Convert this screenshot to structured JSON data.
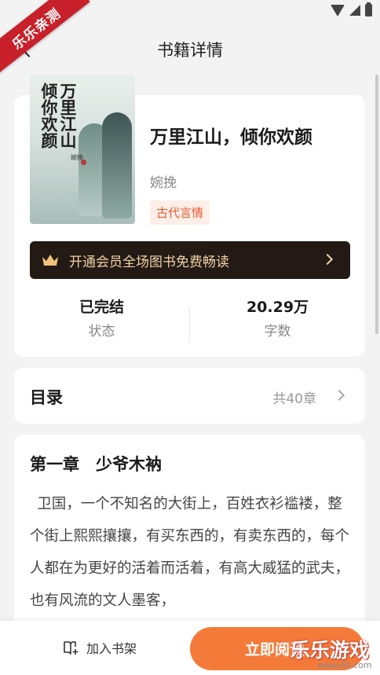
{
  "header": {
    "title": "书籍详情"
  },
  "ribbon": {
    "text": "乐乐亲测"
  },
  "book": {
    "cover_title": "万里江山倾你欢颜",
    "cover_author": "婉挽",
    "name": "万里江山，倾你欢颜",
    "author": "婉挽",
    "genre": "古代言情"
  },
  "vip": {
    "text": "开通会员全场图书免费畅读"
  },
  "stats": {
    "status_value": "已完结",
    "status_label": "状态",
    "words_value": "20.29万",
    "words_label": "字数"
  },
  "toc": {
    "title": "目录",
    "count": "共40章"
  },
  "preview": {
    "chapter_title": "第一章　少爷木衲",
    "text": "卫国，一个不知名的大街上，百姓衣衫褴褛，整个街上熙熙攘攘，有买东西的，有卖东西的，每个人都在为更好的活着而活着，有高大威猛的武夫，也有风流的文人墨客，"
  },
  "bottom": {
    "shelf_label": "加入书架",
    "read_label": "立即阅读"
  },
  "watermark": {
    "logo": "乐乐游戏",
    "url": "www.6ll.com"
  },
  "icons": [
    "wifi-icon",
    "signal-icon",
    "battery-icon",
    "back-arrow-icon",
    "crown-icon",
    "chevron-right-icon",
    "add-bookshelf-icon"
  ],
  "colors": {
    "accent": "#f47a3a",
    "tag_text": "#e55a30",
    "vip_bg": "#231a15",
    "vip_text": "#f0d2a6"
  }
}
